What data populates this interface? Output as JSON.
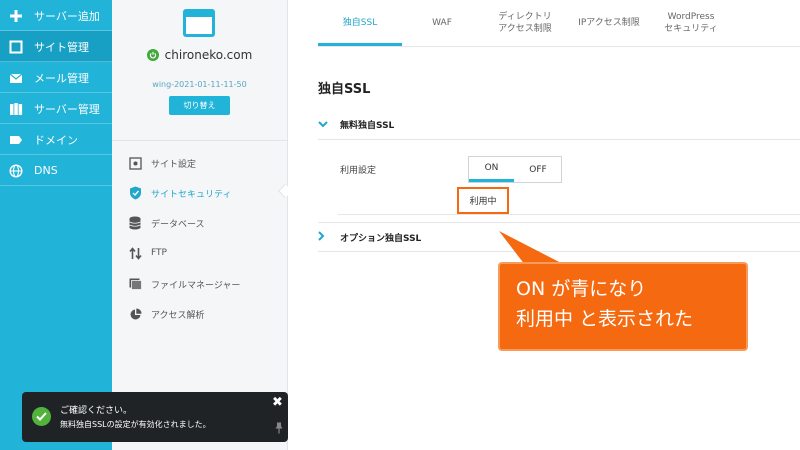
{
  "nav": {
    "items": [
      {
        "label": "サーバー追加",
        "icon": "plus-icon"
      },
      {
        "label": "サイト管理",
        "icon": "window-icon"
      },
      {
        "label": "メール管理",
        "icon": "mail-icon"
      },
      {
        "label": "サーバー管理",
        "icon": "server-icon"
      },
      {
        "label": "ドメイン",
        "icon": "tag-icon"
      },
      {
        "label": "DNS",
        "icon": "globe-icon"
      }
    ],
    "active_index": 1
  },
  "site": {
    "domain": "chironeko.com",
    "server_id": "wing-2021-01-11-11-50",
    "switch_label": "切り替え"
  },
  "submenu": {
    "items": [
      {
        "label": "サイト設定",
        "icon": "settings-icon"
      },
      {
        "label": "サイトセキュリティ",
        "icon": "shield-icon"
      },
      {
        "label": "データベース",
        "icon": "database-icon"
      },
      {
        "label": "FTP",
        "icon": "transfer-icon"
      },
      {
        "label": "ファイルマネージャー",
        "icon": "folder-icon"
      },
      {
        "label": "アクセス解析",
        "icon": "pie-chart-icon"
      }
    ],
    "active_index": 1
  },
  "tabs": [
    {
      "label": "独自SSL"
    },
    {
      "label": "WAF"
    },
    {
      "label1": "ディレクトリ",
      "label2": "アクセス制限"
    },
    {
      "label": "IPアクセス制限"
    },
    {
      "label1": "WordPress",
      "label2": "セキュリティ"
    }
  ],
  "main": {
    "title": "独自SSL",
    "section1": "無料独自SSL",
    "setting_label": "利用設定",
    "toggle_on": "ON",
    "toggle_off": "OFF",
    "status": "利用中",
    "section2": "オプション独自SSL"
  },
  "callout": {
    "line1": "ON が青になり",
    "line2": "利用中 と表示された"
  },
  "toast": {
    "line1": "ご確認ください。",
    "line2": "無料独自SSLの設定が有効化されました。",
    "close": "✖"
  },
  "colors": {
    "accent": "#21b3d8",
    "callout": "#f56a10",
    "success": "#52b33c",
    "toast_bg": "#1f2326"
  }
}
